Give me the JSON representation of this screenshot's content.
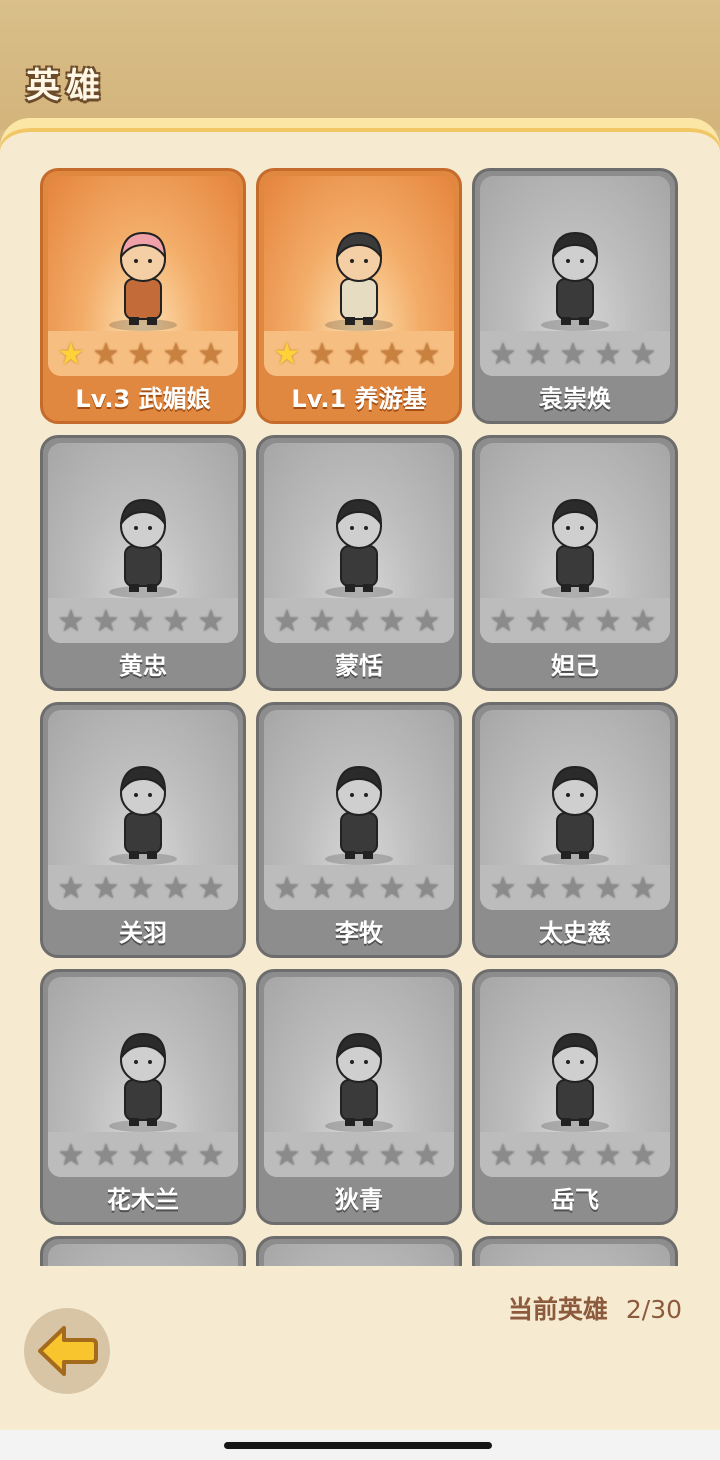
{
  "header": {
    "title": "英雄"
  },
  "heroes": [
    {
      "name": "武媚娘",
      "level": "Lv.3",
      "owned": true,
      "stars": 1
    },
    {
      "name": "养游基",
      "level": "Lv.1",
      "owned": true,
      "stars": 1
    },
    {
      "name": "袁崇焕",
      "level": "",
      "owned": false,
      "stars": 0
    },
    {
      "name": "黄忠",
      "level": "",
      "owned": false,
      "stars": 0
    },
    {
      "name": "蒙恬",
      "level": "",
      "owned": false,
      "stars": 0
    },
    {
      "name": "妲己",
      "level": "",
      "owned": false,
      "stars": 0
    },
    {
      "name": "关羽",
      "level": "",
      "owned": false,
      "stars": 0
    },
    {
      "name": "李牧",
      "level": "",
      "owned": false,
      "stars": 0
    },
    {
      "name": "太史慈",
      "level": "",
      "owned": false,
      "stars": 0
    },
    {
      "name": "花木兰",
      "level": "",
      "owned": false,
      "stars": 0
    },
    {
      "name": "狄青",
      "level": "",
      "owned": false,
      "stars": 0
    },
    {
      "name": "岳飞",
      "level": "",
      "owned": false,
      "stars": 0
    }
  ],
  "footer": {
    "label": "当前英雄",
    "count": "2/30"
  },
  "back_button": {
    "icon": "arrow-left-icon"
  },
  "colors": {
    "owned": "#e08840",
    "locked": "#8d8d8d",
    "star_on": "#ffd23a",
    "panel": "#f6ead0"
  }
}
